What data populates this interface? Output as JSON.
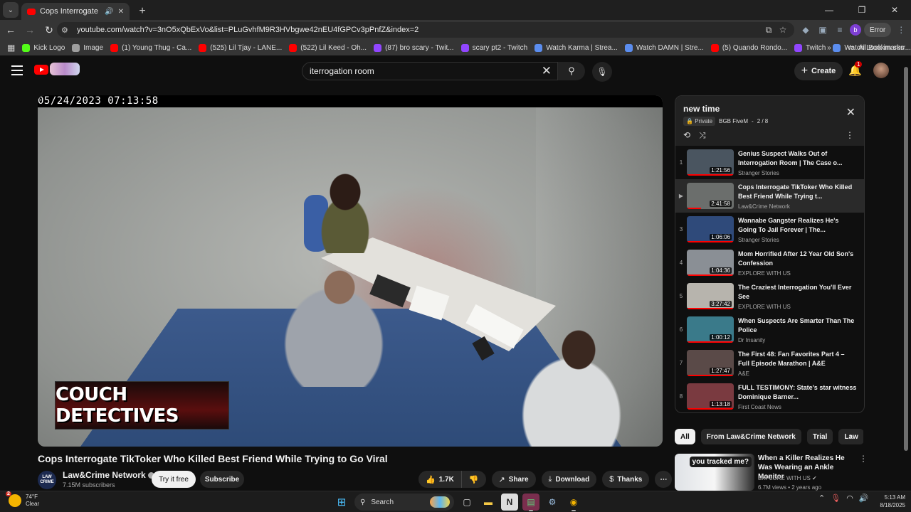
{
  "browser": {
    "tab_title": "Cops Interrogate TikToker Wh",
    "url": "youtube.com/watch?v=3nO5xQbExVo&list=PLuGvhfM9R3HVbgwe42nEU4fGPCv3pPnfZ&index=2",
    "error_label": "Error",
    "profile_initial": "b",
    "bookmarks": [
      {
        "label": "Kick Logo",
        "color": "#53fc18"
      },
      {
        "label": "Image",
        "color": "#9e9e9e"
      },
      {
        "label": "(1) Young Thug - Ca...",
        "color": "#ff0000"
      },
      {
        "label": "(525) Lil Tjay - LANE...",
        "color": "#ff0000"
      },
      {
        "label": "(522) Lil Keed - Oh...",
        "color": "#ff0000"
      },
      {
        "label": "(87) bro scary - Twit...",
        "color": "#9146ff"
      },
      {
        "label": "scary pt2 - Twitch",
        "color": "#9146ff"
      },
      {
        "label": "Watch Karma | Strea...",
        "color": "#5b8def"
      },
      {
        "label": "Watch DAMN | Stre...",
        "color": "#5b8def"
      },
      {
        "label": "(5) Quando Rondo...",
        "color": "#ff0000"
      },
      {
        "label": "Twitch",
        "color": "#9146ff"
      },
      {
        "label": "Watch Look im sorr...",
        "color": "#5b8def"
      }
    ],
    "all_bookmarks": "All Bookmarks"
  },
  "header": {
    "search_query": "iterrogation room",
    "create_label": "Create",
    "notif_count": "1"
  },
  "video": {
    "timestamp": "05/24/2023 07:13:58",
    "overlay_logo": "COUCH DETECTIVES",
    "title": "Cops Interrogate TikToker Who Killed Best Friend While Trying to Go Viral",
    "channel": "Law&Crime Network",
    "subscribers": "7.15M subscribers",
    "try_free": "Try it free",
    "subscribe": "Subscribe",
    "likes": "1.7K",
    "share": "Share",
    "download": "Download",
    "thanks": "Thanks"
  },
  "playlist": {
    "title": "new time",
    "privacy": "Private",
    "owner": "BGB FiveM",
    "position": "2 / 8",
    "items": [
      {
        "index": "1",
        "title": "Genius Suspect Walks Out of Interrogation Room | The Case o...",
        "channel": "Stranger Stories",
        "duration": "1:21:56",
        "thumb": "#4a5560"
      },
      {
        "index": "▶",
        "title": "Cops Interrogate TikToker Who Killed Best Friend While Trying t...",
        "channel": "Law&Crime Network",
        "duration": "2:41:58",
        "thumb": "#6b6e6c"
      },
      {
        "index": "3",
        "title": "Wannabe Gangster Realizes He's Going To Jail Forever | The...",
        "channel": "Stranger Stories",
        "duration": "1:06:06",
        "thumb": "#2f4a7a"
      },
      {
        "index": "4",
        "title": "Mom Horrified After 12 Year Old Son's Confession",
        "channel": "EXPLORE WITH US",
        "duration": "1:04:36",
        "thumb": "#8a8f95"
      },
      {
        "index": "5",
        "title": "The Craziest Interrogation You'll Ever See",
        "channel": "EXPLORE WITH US",
        "duration": "3:27:42",
        "thumb": "#b7b4ad"
      },
      {
        "index": "6",
        "title": "When Suspects Are Smarter Than The Police",
        "channel": "Dr Insanity",
        "duration": "1:00:12",
        "thumb": "#3a7a8a"
      },
      {
        "index": "7",
        "title": "The First 48: Fan Favorites Part 4 – Full Episode Marathon | A&E",
        "channel": "A&E",
        "duration": "1:27:47",
        "thumb": "#5a4a48"
      },
      {
        "index": "8",
        "title": "FULL TESTIMONY: State's star witness Dominique Barner...",
        "channel": "First Coast News",
        "duration": "1:13:18",
        "thumb": "#7a3a40"
      }
    ]
  },
  "chips": [
    "All",
    "From Law&Crime Network",
    "Trial",
    "Law"
  ],
  "recommendation": {
    "title": "When a Killer Realizes He Was Wearing an Ankle Monitor",
    "channel": "EXPLORE WITH US",
    "stats": "6.7M views • 2 years ago",
    "thumb_caption": "you tracked me?"
  },
  "taskbar": {
    "temp": "74°F",
    "condition": "Clear",
    "weather_badge": "2",
    "search_label": "Search",
    "time": "5:13 AM",
    "date": "8/18/2025"
  }
}
